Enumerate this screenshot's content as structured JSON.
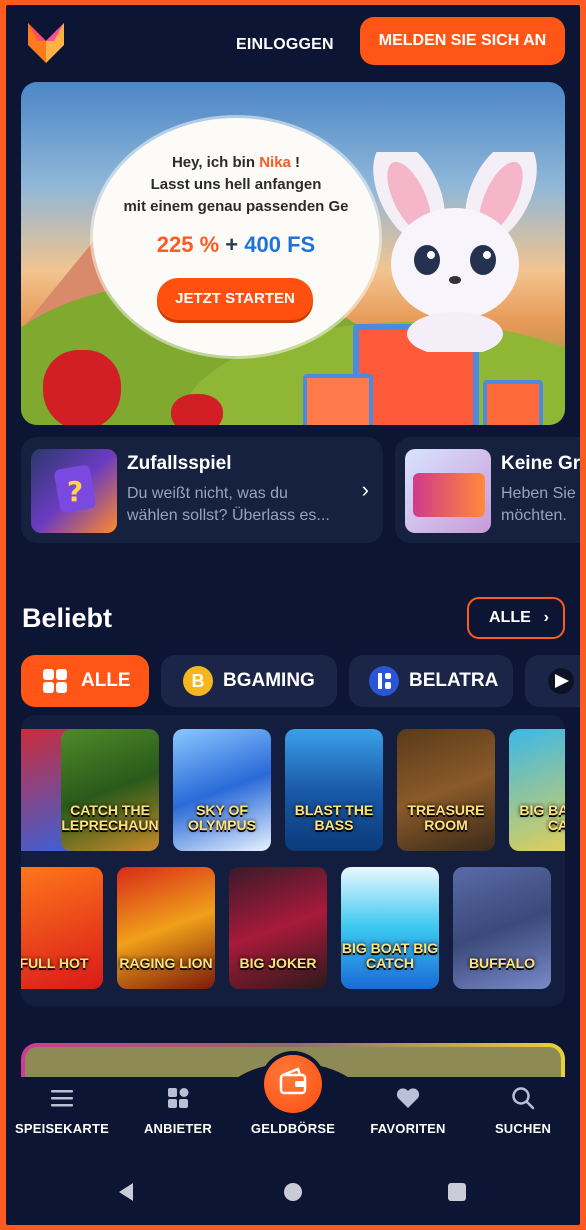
{
  "header": {
    "login_label": "EINLOGGEN",
    "signup_label": "MELDEN SIE SICH AN"
  },
  "hero": {
    "line1_prefix": "Hey, ich bin ",
    "line1_name": "Nika",
    "line1_suffix": " !",
    "line2": "Lasst uns hell anfangen",
    "line3": "mit einem genau passenden Ge",
    "bonus_percent": "225 %",
    "bonus_plus": "+",
    "bonus_fs": "400 FS",
    "cta_label": "JETZT STARTEN"
  },
  "cards": [
    {
      "title": "Zufallsspiel",
      "desc_line1": "Du weißt nicht, was du",
      "desc_line2": "wählen sollst? Überlass es..."
    },
    {
      "title": "Keine Gre",
      "desc_line1": "Heben Sie",
      "desc_line2": "möchten."
    }
  ],
  "popular": {
    "title": "Beliebt",
    "all_label": "ALLE",
    "chips": [
      {
        "label": "ALLE"
      },
      {
        "label": "BGAMING",
        "icon_letter": "B"
      },
      {
        "label": "BELATRA"
      }
    ],
    "games_row1": [
      "",
      "CATCH THE LEPRECHAUN",
      "SKY OF OLYMPUS",
      "BLAST THE BASS",
      "TREASURE ROOM",
      "BIG BA BIG CA"
    ],
    "games_row2": [
      "FULL HOT",
      "RAGING LION",
      "BIG JOKER",
      "BIG BOAT BIG CATCH",
      "BUFFALO"
    ]
  },
  "nav": {
    "items": [
      {
        "label": "SPEISEKARTE",
        "icon": "menu-icon"
      },
      {
        "label": "ANBIETER",
        "icon": "providers-icon"
      },
      {
        "label": "GELDBÖRSE",
        "icon": "wallet-icon"
      },
      {
        "label": "FAVORITEN",
        "icon": "heart-icon"
      },
      {
        "label": "SUCHEN",
        "icon": "search-icon"
      }
    ]
  },
  "colors": {
    "accent": "#ff5617",
    "background": "#0c1533",
    "card": "#16213f"
  }
}
